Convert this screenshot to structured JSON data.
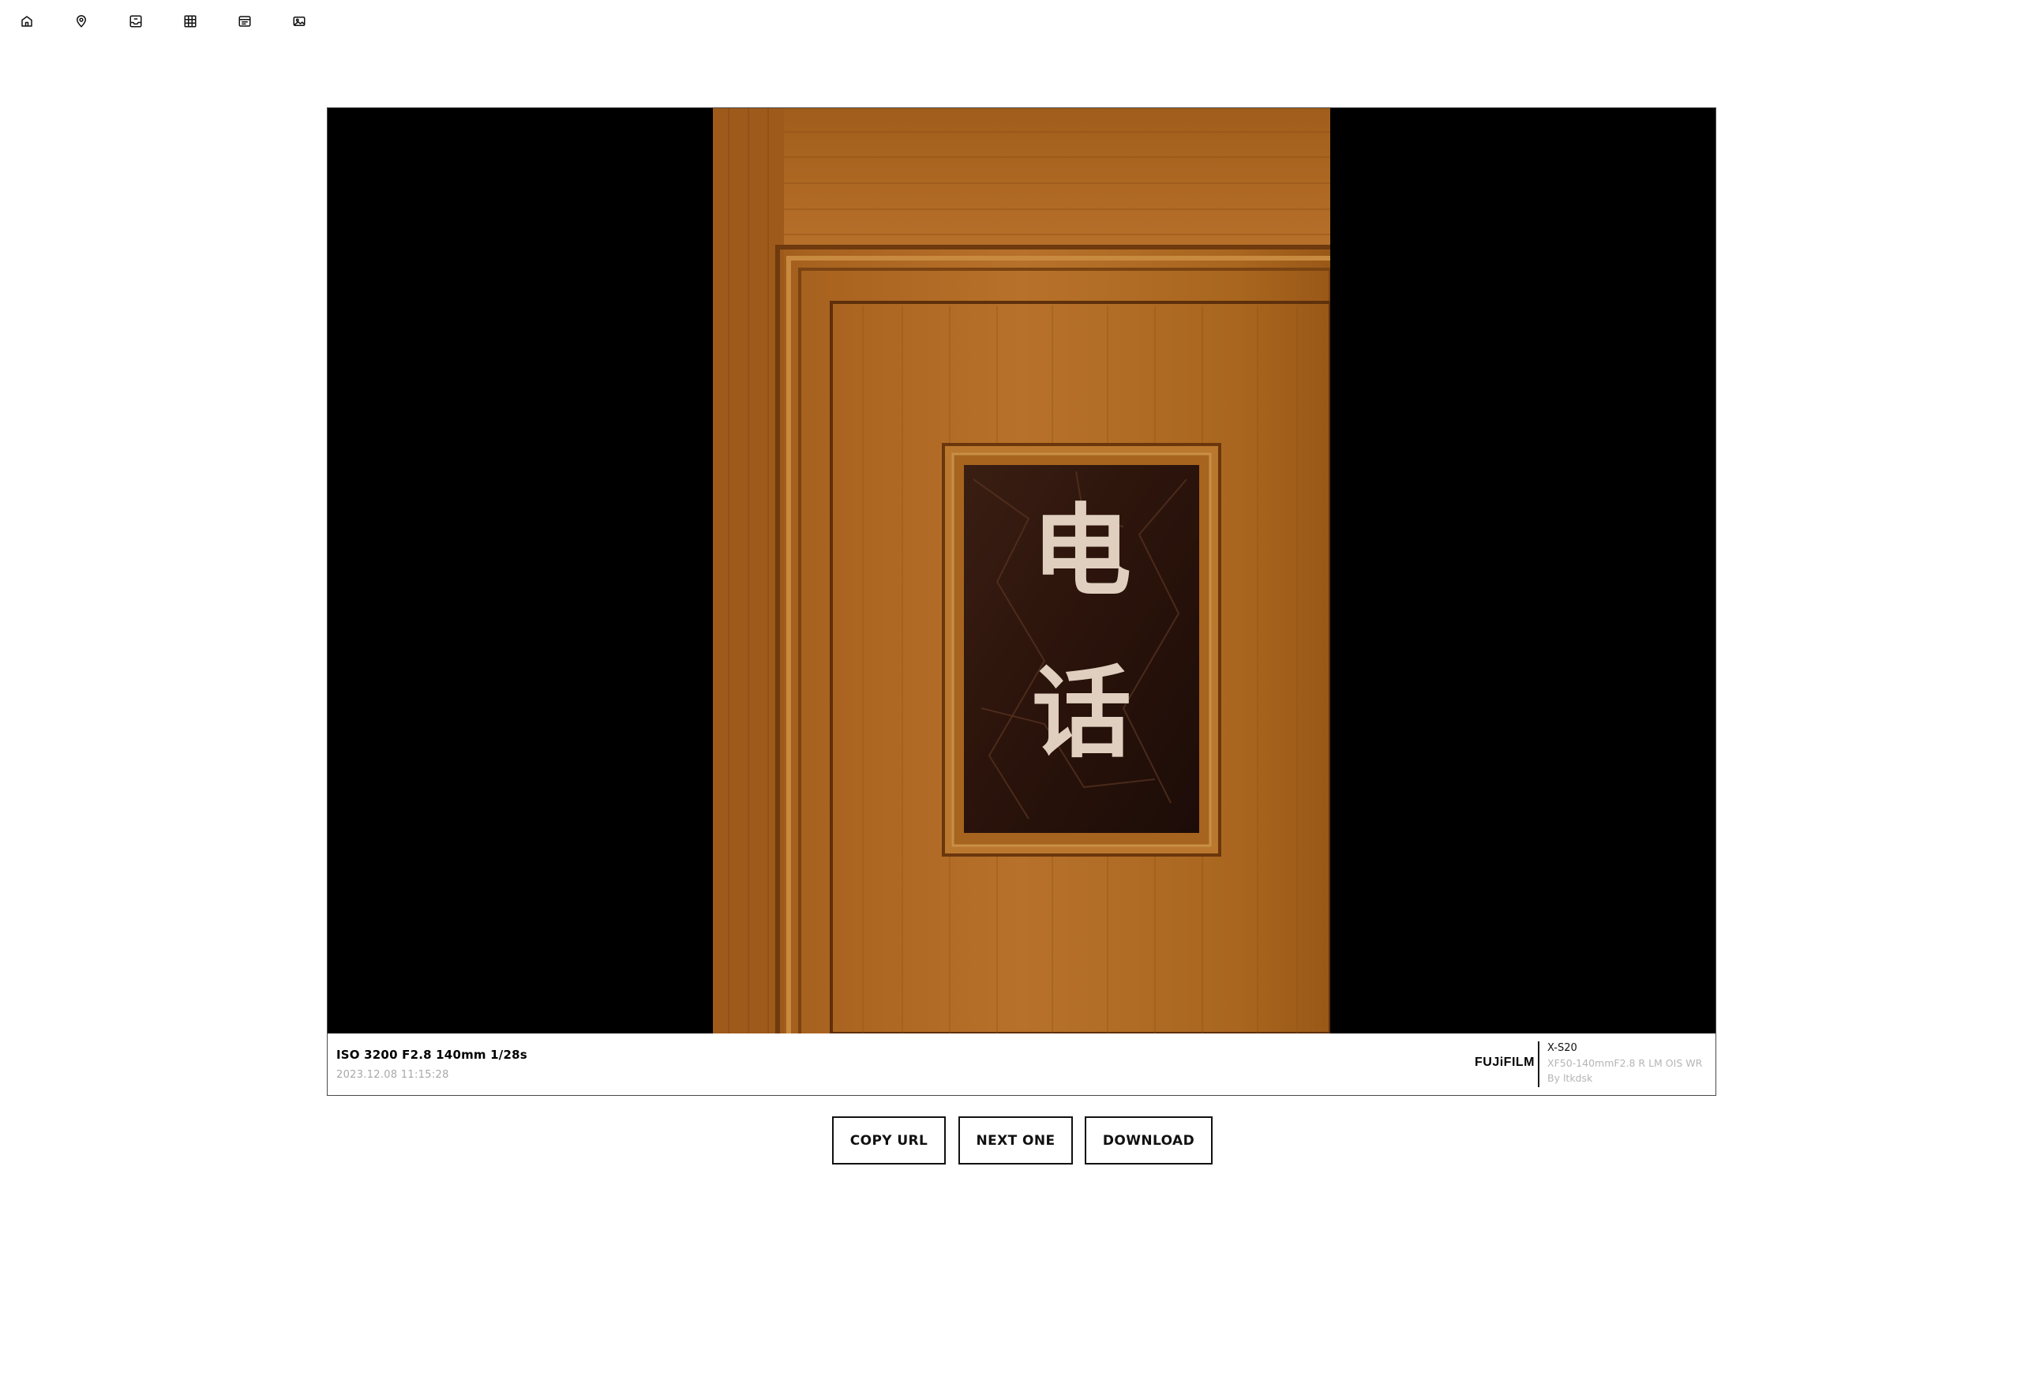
{
  "toolbar": {
    "icons": [
      "home-icon",
      "map-pin-icon",
      "inbox-icon",
      "grid-icon",
      "list-icon",
      "image-icon"
    ]
  },
  "photo": {
    "description_icon": "photo-of-wooden-door-with-sign",
    "sign_text": "电话"
  },
  "meta": {
    "exif": "ISO 3200 F2.8 140mm 1/28s",
    "datetime": "2023.12.08 11:15:28",
    "brand": "FUJiFILM",
    "camera_model": "X-S20",
    "lens": "XF50-140mmF2.8 R LM OIS WR",
    "author": "By ltkdsk"
  },
  "actions": {
    "copy_url": "COPY URL",
    "next_one": "NEXT ONE",
    "download": "DOWNLOAD"
  }
}
